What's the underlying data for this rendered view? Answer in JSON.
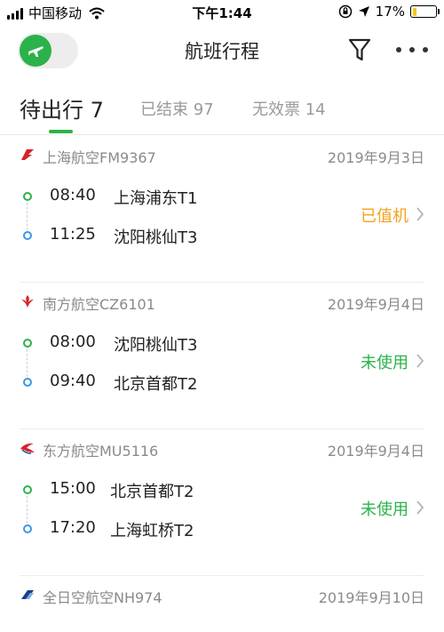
{
  "status_bar": {
    "carrier": "中国移动",
    "time": "下午1:44",
    "battery_percent": "17%",
    "battery_level": 0.17
  },
  "nav": {
    "title": "航班行程"
  },
  "tabs": [
    {
      "label": "待出行 7",
      "active": true
    },
    {
      "label": "已结束 97",
      "active": false
    },
    {
      "label": "无效票 14",
      "active": false
    }
  ],
  "colors": {
    "brand_green": "#2cb24a",
    "checked_in_orange": "#f5a21b",
    "unused_green": "#2cb24a",
    "arrival_blue": "#3b97e3"
  },
  "flights": [
    {
      "airline": "上海航空FM9367",
      "logo": "shanghai-airlines-logo",
      "date": "2019年9月3日",
      "dep_time": "08:40",
      "dep_place": "上海浦东T1",
      "arr_time": "11:25",
      "arr_place": "沈阳桃仙T3",
      "status": "已值机"
    },
    {
      "airline": "南方航空CZ6101",
      "logo": "china-southern-logo",
      "date": "2019年9月4日",
      "dep_time": "08:00",
      "dep_place": "沈阳桃仙T3",
      "arr_time": "09:40",
      "arr_place": "北京首都T2",
      "status": "未使用"
    },
    {
      "airline": "东方航空MU5116",
      "logo": "china-eastern-logo",
      "date": "2019年9月4日",
      "dep_time": "15:00",
      "dep_place": "北京首都T2",
      "arr_time": "17:20",
      "arr_place": "上海虹桥T2",
      "status": "未使用"
    },
    {
      "airline": "全日空航空NH974",
      "logo": "ana-logo",
      "date": "2019年9月10日"
    }
  ]
}
